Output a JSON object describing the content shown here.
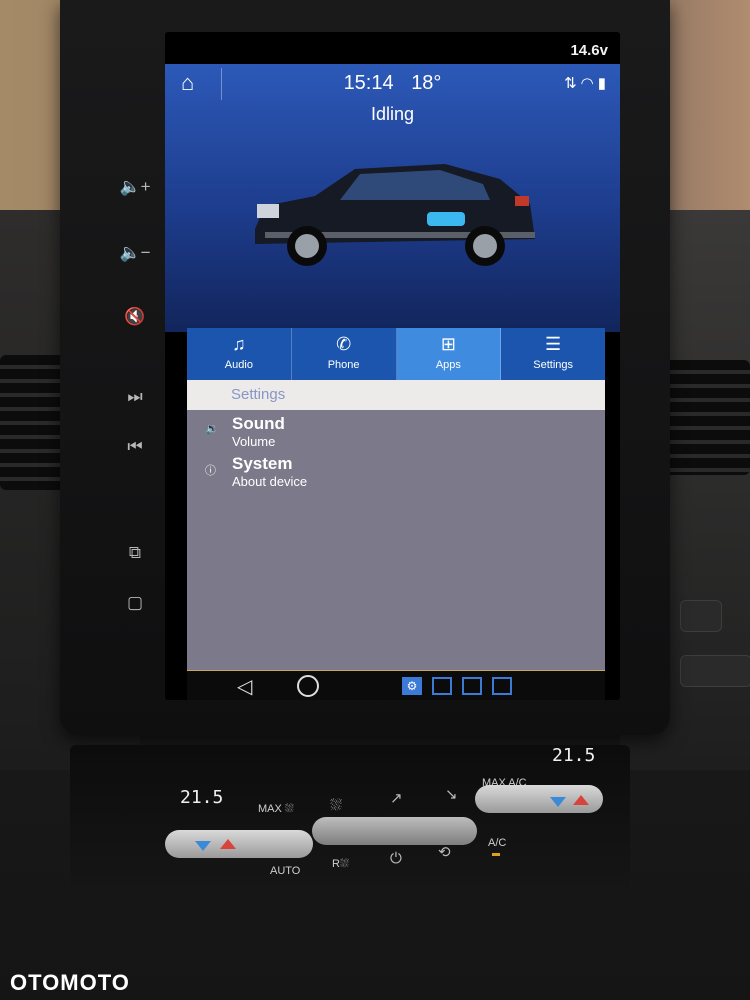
{
  "status": {
    "voltage": "14.6v",
    "time": "15:14",
    "temperature": "18°",
    "vehicle_state": "Idling"
  },
  "tabs": [
    {
      "label": "Audio",
      "icon": "music-note-icon"
    },
    {
      "label": "Phone",
      "icon": "phone-icon"
    },
    {
      "label": "Apps",
      "icon": "apps-grid-icon",
      "active": true
    },
    {
      "label": "Settings",
      "icon": "sliders-icon"
    }
  ],
  "settings": {
    "header": "Settings",
    "items": [
      {
        "title": "Sound",
        "subtitle": "Volume",
        "icon": "speaker-icon"
      },
      {
        "title": "System",
        "subtitle": "About device",
        "icon": "info-icon"
      }
    ]
  },
  "climate": {
    "left_temp": "21.5",
    "right_temp": "21.5",
    "max_label": "MAX",
    "max_ac_label": "MAX A/C",
    "auto_label": "AUTO",
    "ac_label": "A/C",
    "rear_label": "R"
  },
  "watermark": "OTOMOTO",
  "colors": {
    "accent": "#3f8be0",
    "tab_bg": "#1b55ad",
    "panel_bg": "#7c7a8a"
  }
}
